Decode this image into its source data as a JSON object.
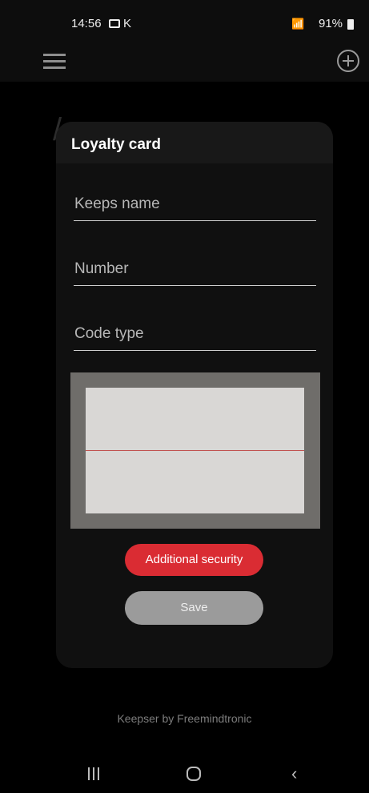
{
  "status_bar": {
    "time": "14:56",
    "notification_letter": "K",
    "signal_icon": "wifi-signal-icon",
    "battery_text": "91%"
  },
  "app_bar": {
    "menu_icon": "hamburger-menu-icon",
    "add_icon": "add-circle-icon"
  },
  "dialog": {
    "title": "Loyalty card",
    "fields": [
      {
        "placeholder": "Keeps name"
      },
      {
        "placeholder": "Number"
      },
      {
        "placeholder": "Code type"
      }
    ],
    "additional_security_label": "Additional security",
    "save_label": "Save"
  },
  "footer": {
    "text": "Keepser by Freemindtronic"
  },
  "nav_bar": {
    "recent_icon": "recent-apps-icon",
    "home_icon": "home-icon",
    "back_icon": "back-icon"
  },
  "colors": {
    "accent_red": "#da2c33",
    "save_grey": "#9b9b9b",
    "dialog_bg": "#101010"
  }
}
